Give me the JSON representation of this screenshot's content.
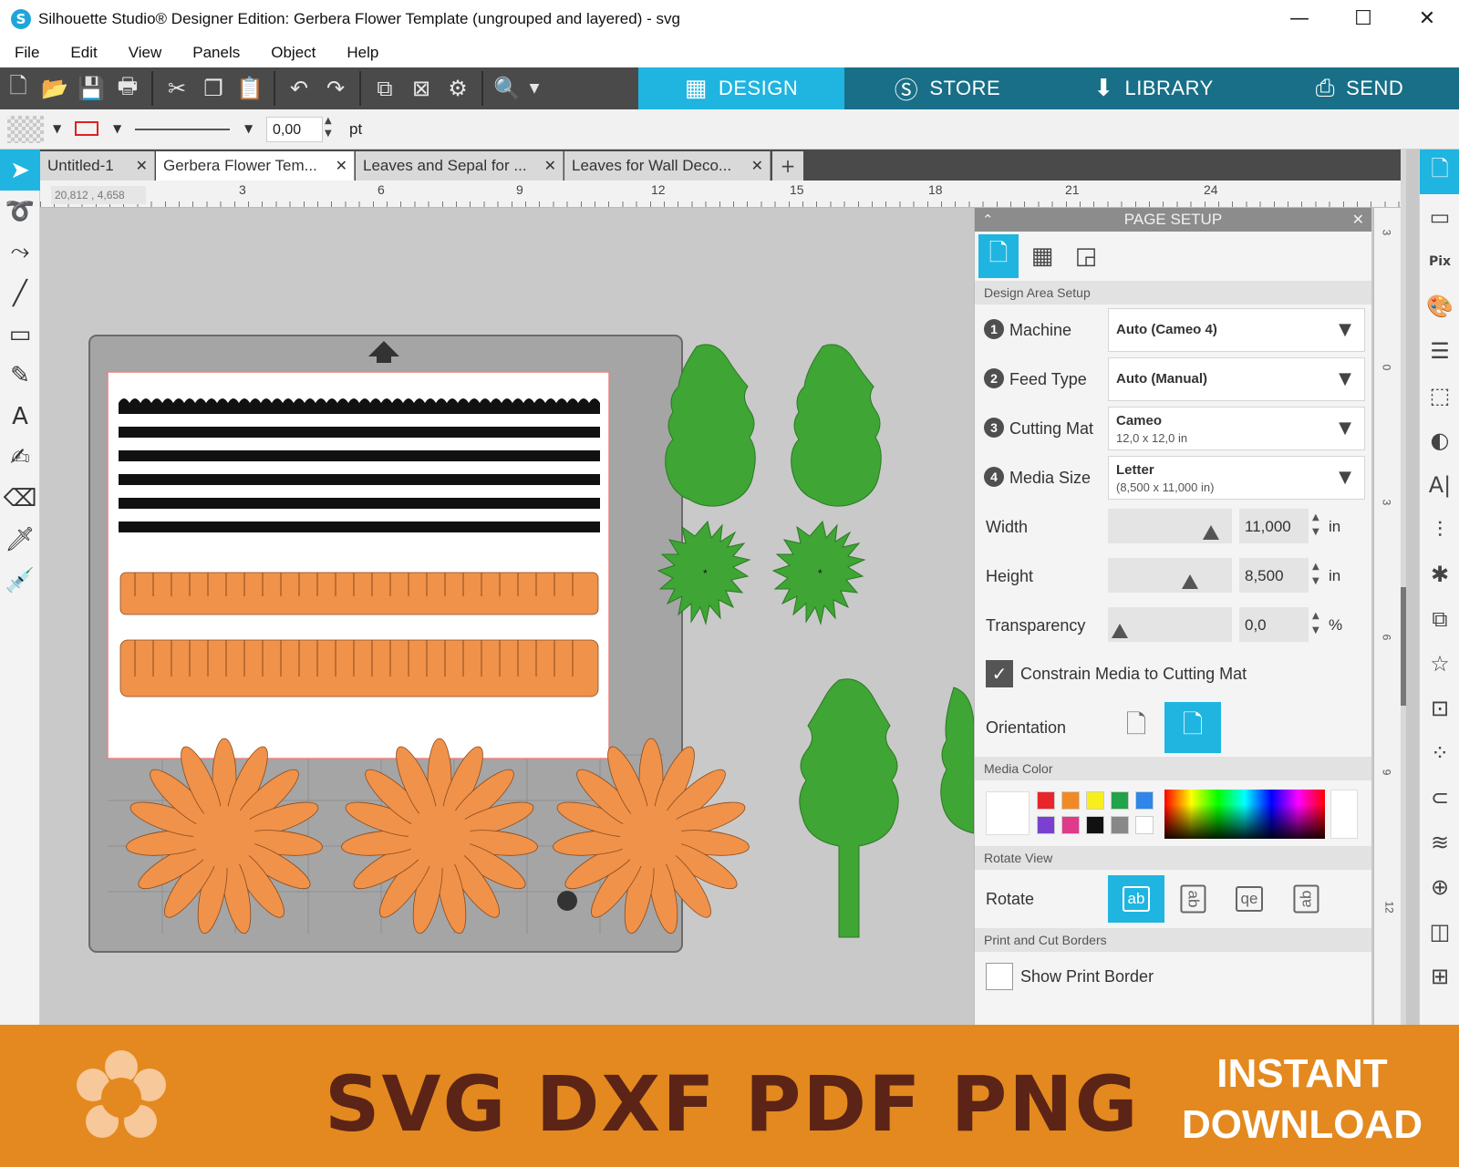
{
  "window": {
    "title": "Silhouette Studio® Designer Edition: Gerbera Flower Template (ungrouped and layered) - svg",
    "minimize": "—",
    "maximize": "☐",
    "close": "✕"
  },
  "menu": [
    "File",
    "Edit",
    "View",
    "Panels",
    "Object",
    "Help"
  ],
  "nav_tabs": [
    {
      "label": "DESIGN",
      "active": true
    },
    {
      "label": "STORE",
      "active": false
    },
    {
      "label": "LIBRARY",
      "active": false
    },
    {
      "label": "SEND",
      "active": false
    }
  ],
  "properties": {
    "line_weight": "0,00",
    "line_unit": "pt"
  },
  "doc_tabs": [
    {
      "label": "Untitled-1",
      "active": false
    },
    {
      "label": "Gerbera Flower Tem...",
      "active": true
    },
    {
      "label": "Leaves and Sepal for ...",
      "active": false
    },
    {
      "label": "Leaves for Wall Deco...",
      "active": false
    }
  ],
  "add_tab": "+",
  "ruler": {
    "coords": "20,812 , 4,658",
    "h_ticks": [
      "3",
      "6",
      "9",
      "12",
      "15",
      "18",
      "21",
      "24"
    ],
    "v_ticks": [
      "3",
      "0",
      "3",
      "6",
      "9",
      "12"
    ]
  },
  "panel": {
    "title": "PAGE SETUP",
    "sections": {
      "design_area": "Design Area Setup",
      "media_color": "Media Color",
      "rotate_view": "Rotate View",
      "borders": "Print and Cut Borders"
    },
    "machine": {
      "num": "1",
      "label": "Machine",
      "value": "Auto (Cameo 4)"
    },
    "feed_type": {
      "num": "2",
      "label": "Feed Type",
      "value": "Auto (Manual)"
    },
    "cutting_mat": {
      "num": "3",
      "label": "Cutting Mat",
      "value": "Cameo",
      "sub": "12,0 x 12,0 in"
    },
    "media_size": {
      "num": "4",
      "label": "Media Size",
      "value": "Letter",
      "sub": "(8,500 x 11,000 in)"
    },
    "width": {
      "label": "Width",
      "value": "11,000",
      "unit": "in",
      "level": 0.85
    },
    "height": {
      "label": "Height",
      "value": "8,500",
      "unit": "in",
      "level": 0.65
    },
    "transparency": {
      "label": "Transparency",
      "value": "0,0",
      "unit": "%",
      "level": 0.0
    },
    "constrain": {
      "label": "Constrain Media to Cutting Mat",
      "checked": true
    },
    "orientation_label": "Orientation",
    "rotate_label": "Rotate",
    "rotate_options": [
      "ab",
      "ab",
      "qe",
      "ab"
    ],
    "show_print_border": {
      "label": "Show Print Border",
      "checked": false
    },
    "swatches": [
      "#e8252b",
      "#f08a24",
      "#f7ee1e",
      "#22a34a",
      "#2f86e8",
      "#7b3fd1",
      "#e03a8a",
      "#111111",
      "#888888",
      "#ffffff"
    ]
  },
  "banner": {
    "formats": "SVG DXF PDF PNG",
    "line1": "INSTANT",
    "line2": "DOWNLOAD"
  },
  "colors": {
    "accent": "#1fb5e0",
    "banner": "#e3891f",
    "fringe_black": "#111111",
    "petal_orange": "#f0924a",
    "leaf_green": "#3fa535"
  }
}
